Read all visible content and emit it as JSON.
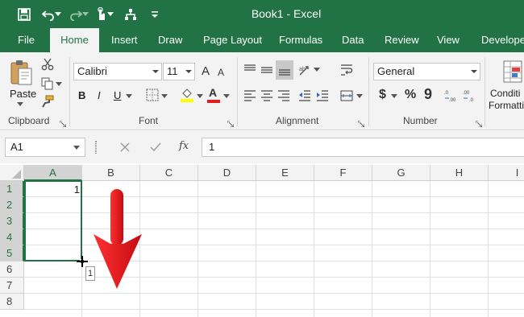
{
  "window": {
    "title": "Book1  -  Excel"
  },
  "tabs": [
    {
      "label": "File"
    },
    {
      "label": "Home"
    },
    {
      "label": "Insert"
    },
    {
      "label": "Draw"
    },
    {
      "label": "Page Layout"
    },
    {
      "label": "Formulas"
    },
    {
      "label": "Data"
    },
    {
      "label": "Review"
    },
    {
      "label": "View"
    },
    {
      "label": "Developer"
    }
  ],
  "ribbon": {
    "clipboard": {
      "paste_label": "Paste",
      "group_label": "Clipboard"
    },
    "font": {
      "name": "Calibri",
      "size": "11",
      "group_label": "Font",
      "bold": "B",
      "italic": "I",
      "underline": "U",
      "grow": "A",
      "shrink": "A",
      "font_color": "A"
    },
    "alignment": {
      "group_label": "Alignment"
    },
    "number": {
      "format": "General",
      "group_label": "Number",
      "currency": "$",
      "percent": "%",
      "comma": "9",
      "inc_decimal": ".0→.00",
      "dec_decimal": ".00→.0"
    },
    "styles": {
      "conditional_line1": "Conditi",
      "conditional_line2": "Formatti"
    }
  },
  "formula_bar": {
    "name_box": "A1",
    "fx_label": "fx",
    "value": "1"
  },
  "grid": {
    "columns": [
      "A",
      "B",
      "C",
      "D",
      "E",
      "F",
      "G",
      "H",
      "I"
    ],
    "rows": [
      "1",
      "2",
      "3",
      "4",
      "5",
      "6",
      "7",
      "8"
    ],
    "selected_column": "A",
    "cell_a1": "1",
    "fill_tooltip": "1"
  },
  "colors": {
    "accent": "#217346",
    "arrow": "#e4141b"
  }
}
